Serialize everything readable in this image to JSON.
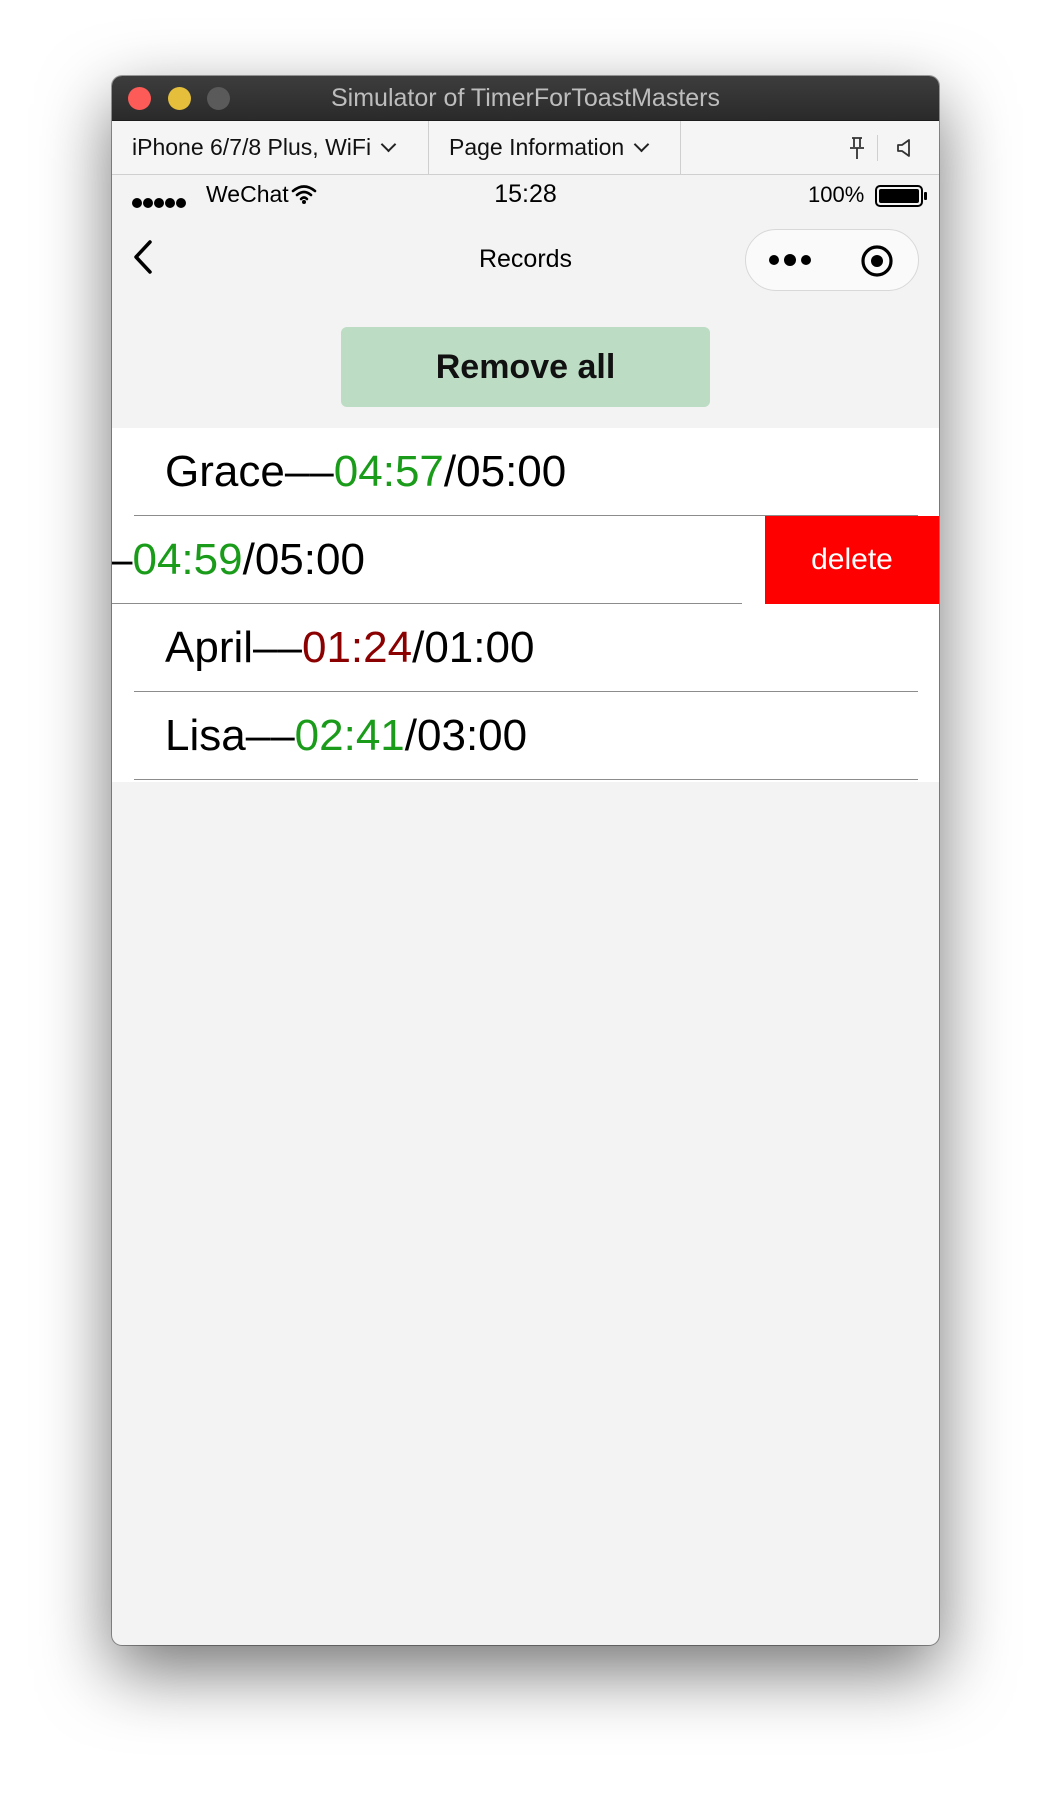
{
  "window": {
    "title": "Simulator of TimerForToastMasters"
  },
  "toolbar": {
    "device_select": "iPhone 6/7/8 Plus, WiFi",
    "page_info_select": "Page Information"
  },
  "status_bar": {
    "carrier": "WeChat",
    "time": "15:28",
    "battery": "100%"
  },
  "nav": {
    "title": "Records"
  },
  "actions": {
    "remove_all": "Remove all"
  },
  "records": [
    {
      "name": "Grace",
      "sep": "––",
      "actual": "04:57",
      "slash": "/",
      "limit": "05:00",
      "status": "ok"
    },
    {
      "name": "",
      "sep": "–",
      "actual": "04:59",
      "slash": "/",
      "limit": "05:00",
      "status": "ok",
      "swiped": true,
      "delete_label": "delete"
    },
    {
      "name": "April",
      "sep": "––",
      "actual": "01:24",
      "slash": "/",
      "limit": "01:00",
      "status": "over"
    },
    {
      "name": "Lisa",
      "sep": "––",
      "actual": "02:41",
      "slash": "/",
      "limit": "03:00",
      "status": "ok"
    }
  ],
  "colors": {
    "within_time": "#1a9c1a",
    "over_time": "#8b0000",
    "delete_bg": "#ff0000",
    "remove_all_bg": "#bcdcc4"
  }
}
